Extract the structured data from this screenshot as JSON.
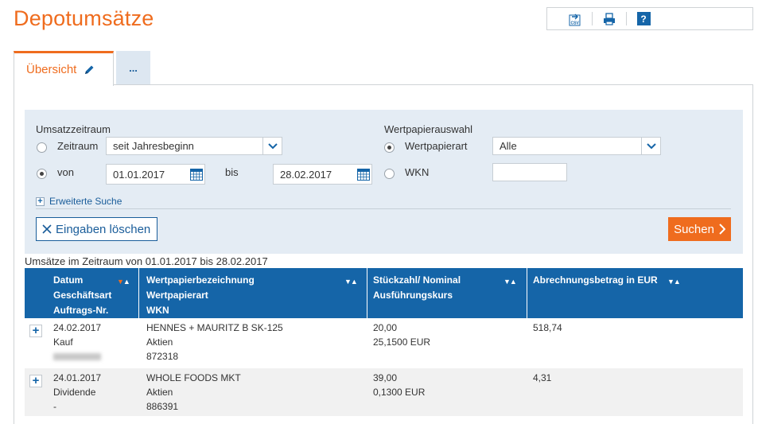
{
  "page": {
    "title": "Depotumsätze"
  },
  "toolbar": {
    "csv_label": "CSV",
    "help_label": "?"
  },
  "tabs": {
    "overview_label": "Übersicht",
    "more_label": "..."
  },
  "filter": {
    "period_heading": "Umsatzzeitraum",
    "period_label": "Zeitraum",
    "period_value": "seit Jahresbeginn",
    "from_label": "von",
    "from_value": "01.01.2017",
    "to_label": "bis",
    "to_value": "28.02.2017",
    "security_heading": "Wertpapierauswahl",
    "security_type_label": "Wertpapierart",
    "security_type_value": "Alle",
    "wkn_label": "WKN",
    "wkn_value": "",
    "advanced_label": "Erweiterte Suche",
    "clear_label": "Eingaben löschen",
    "search_label": "Suchen",
    "selected_mode": "von"
  },
  "results": {
    "range_text": "Umsätze im Zeitraum von 01.01.2017 bis 28.02.2017",
    "headers": {
      "col1": [
        "Datum",
        "Geschäftsart",
        "Auftrags-Nr."
      ],
      "col2": [
        "Wertpapierbezeichnung",
        "Wertpapierart",
        "WKN"
      ],
      "col3": [
        "Stückzahl/ Nominal",
        "Ausführungskurs"
      ],
      "col4": [
        "Abrechnungsbetrag in EUR"
      ]
    },
    "rows": [
      {
        "date": "24.02.2017",
        "type": "Kauf",
        "order_no": "",
        "name": "HENNES + MAURITZ B SK-125",
        "kind": "Aktien",
        "wkn": "872318",
        "quantity": "20,00",
        "price": "25,1500 EUR",
        "amount": "518,74"
      },
      {
        "date": "24.01.2017",
        "type": "Dividende",
        "order_no": "-",
        "name": "WHOLE FOODS MKT",
        "kind": "Aktien",
        "wkn": "886391",
        "quantity": "39,00",
        "price": "0,1300 EUR",
        "amount": "4,31"
      }
    ]
  },
  "colors": {
    "accent": "#ef6c1e",
    "header_blue": "#1565a8",
    "filter_bg": "#e4ecf4"
  }
}
